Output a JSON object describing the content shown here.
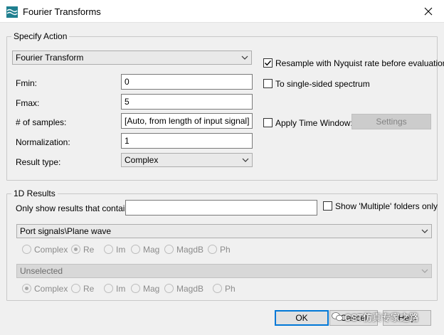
{
  "window": {
    "title": "Fourier Transforms",
    "close_glyph": "×"
  },
  "specify_action": {
    "legend": "Specify Action",
    "transform_select": "Fourier Transform",
    "fmin_label": "Fmin:",
    "fmin_value": "0",
    "fmax_label": "Fmax:",
    "fmax_value": "5",
    "samples_label": "# of samples:",
    "samples_value": "[Auto, from length of input signal]",
    "normalization_label": "Normalization:",
    "normalization_value": "1",
    "result_type_label": "Result type:",
    "result_type_value": "Complex",
    "resample_label": "Resample with Nyquist rate before evaluation",
    "resample_checked": true,
    "single_sided_label": "To single-sided spectrum",
    "single_sided_checked": false,
    "time_window_label": "Apply Time Window:",
    "time_window_checked": false,
    "settings_button": "Settings"
  },
  "results_1d": {
    "legend": "1D Results",
    "filter_label": "Only show results that contain:",
    "filter_value": "",
    "multiple_only_label": "Show 'Multiple' folders only",
    "multiple_only_checked": false,
    "primary_select": "Port signals\\Plane wave",
    "primary_radios": [
      {
        "label": "Complex",
        "checked": false
      },
      {
        "label": "Re",
        "checked": true
      },
      {
        "label": "Im",
        "checked": false
      },
      {
        "label": "Mag",
        "checked": false
      },
      {
        "label": "MagdB",
        "checked": false
      },
      {
        "label": "Ph",
        "checked": false
      }
    ],
    "secondary_select": "Unselected",
    "secondary_radios": [
      {
        "label": "Complex",
        "checked": true
      },
      {
        "label": "Re",
        "checked": false
      },
      {
        "label": "Im",
        "checked": false
      },
      {
        "label": "Mag",
        "checked": false
      },
      {
        "label": "MagdB",
        "checked": false
      },
      {
        "label": "Ph",
        "checked": false
      }
    ]
  },
  "footer": {
    "ok_button": "OK",
    "cancel_button": "Cancel",
    "help_button": "Help"
  },
  "watermark": {
    "text": "CST仿真专家之路"
  },
  "colors": {
    "accent": "#0078d7",
    "dialog_bg": "#f0f0f0",
    "app_icon": "#1f7f8f"
  }
}
